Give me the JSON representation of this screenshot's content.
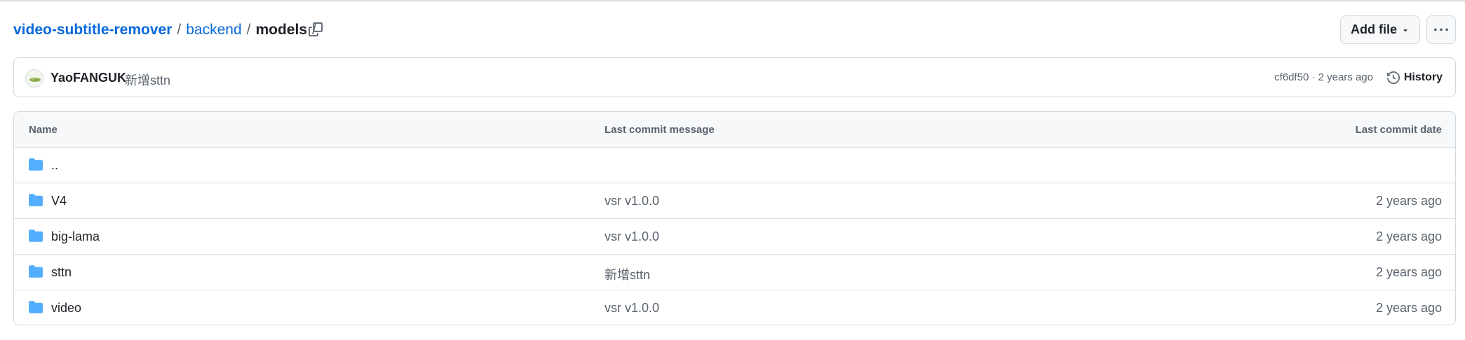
{
  "breadcrumb": {
    "repo": "video-subtitle-remover",
    "sep1": "/",
    "folder": "backend",
    "sep2": "/",
    "current": "models",
    "sep3": "/"
  },
  "actions": {
    "add_file_label": "Add file"
  },
  "latest_commit": {
    "author": "YaoFANGUK",
    "message": "新增sttn",
    "meta": "cf6df50 · 2 years ago",
    "history_label": "History"
  },
  "table": {
    "headers": {
      "name": "Name",
      "message": "Last commit message",
      "date": "Last commit date"
    },
    "rows": [
      {
        "name": "..",
        "message": "",
        "date": ""
      },
      {
        "name": "V4",
        "message": "vsr v1.0.0",
        "date": "2 years ago"
      },
      {
        "name": "big-lama",
        "message": "vsr v1.0.0",
        "date": "2 years ago"
      },
      {
        "name": "sttn",
        "message": "新增sttn",
        "date": "2 years ago"
      },
      {
        "name": "video",
        "message": "vsr v1.0.0",
        "date": "2 years ago"
      }
    ]
  },
  "colors": {
    "link": "#0969da",
    "folder_icon": "#54aeff",
    "muted_text": "#59636e",
    "border": "#d1d9e0"
  },
  "icons": {
    "copy": "copy-icon",
    "triangle_down": "triangle-down-icon",
    "kebab": "kebab-horizontal-icon",
    "history": "history-icon",
    "folder": "folder-icon"
  }
}
